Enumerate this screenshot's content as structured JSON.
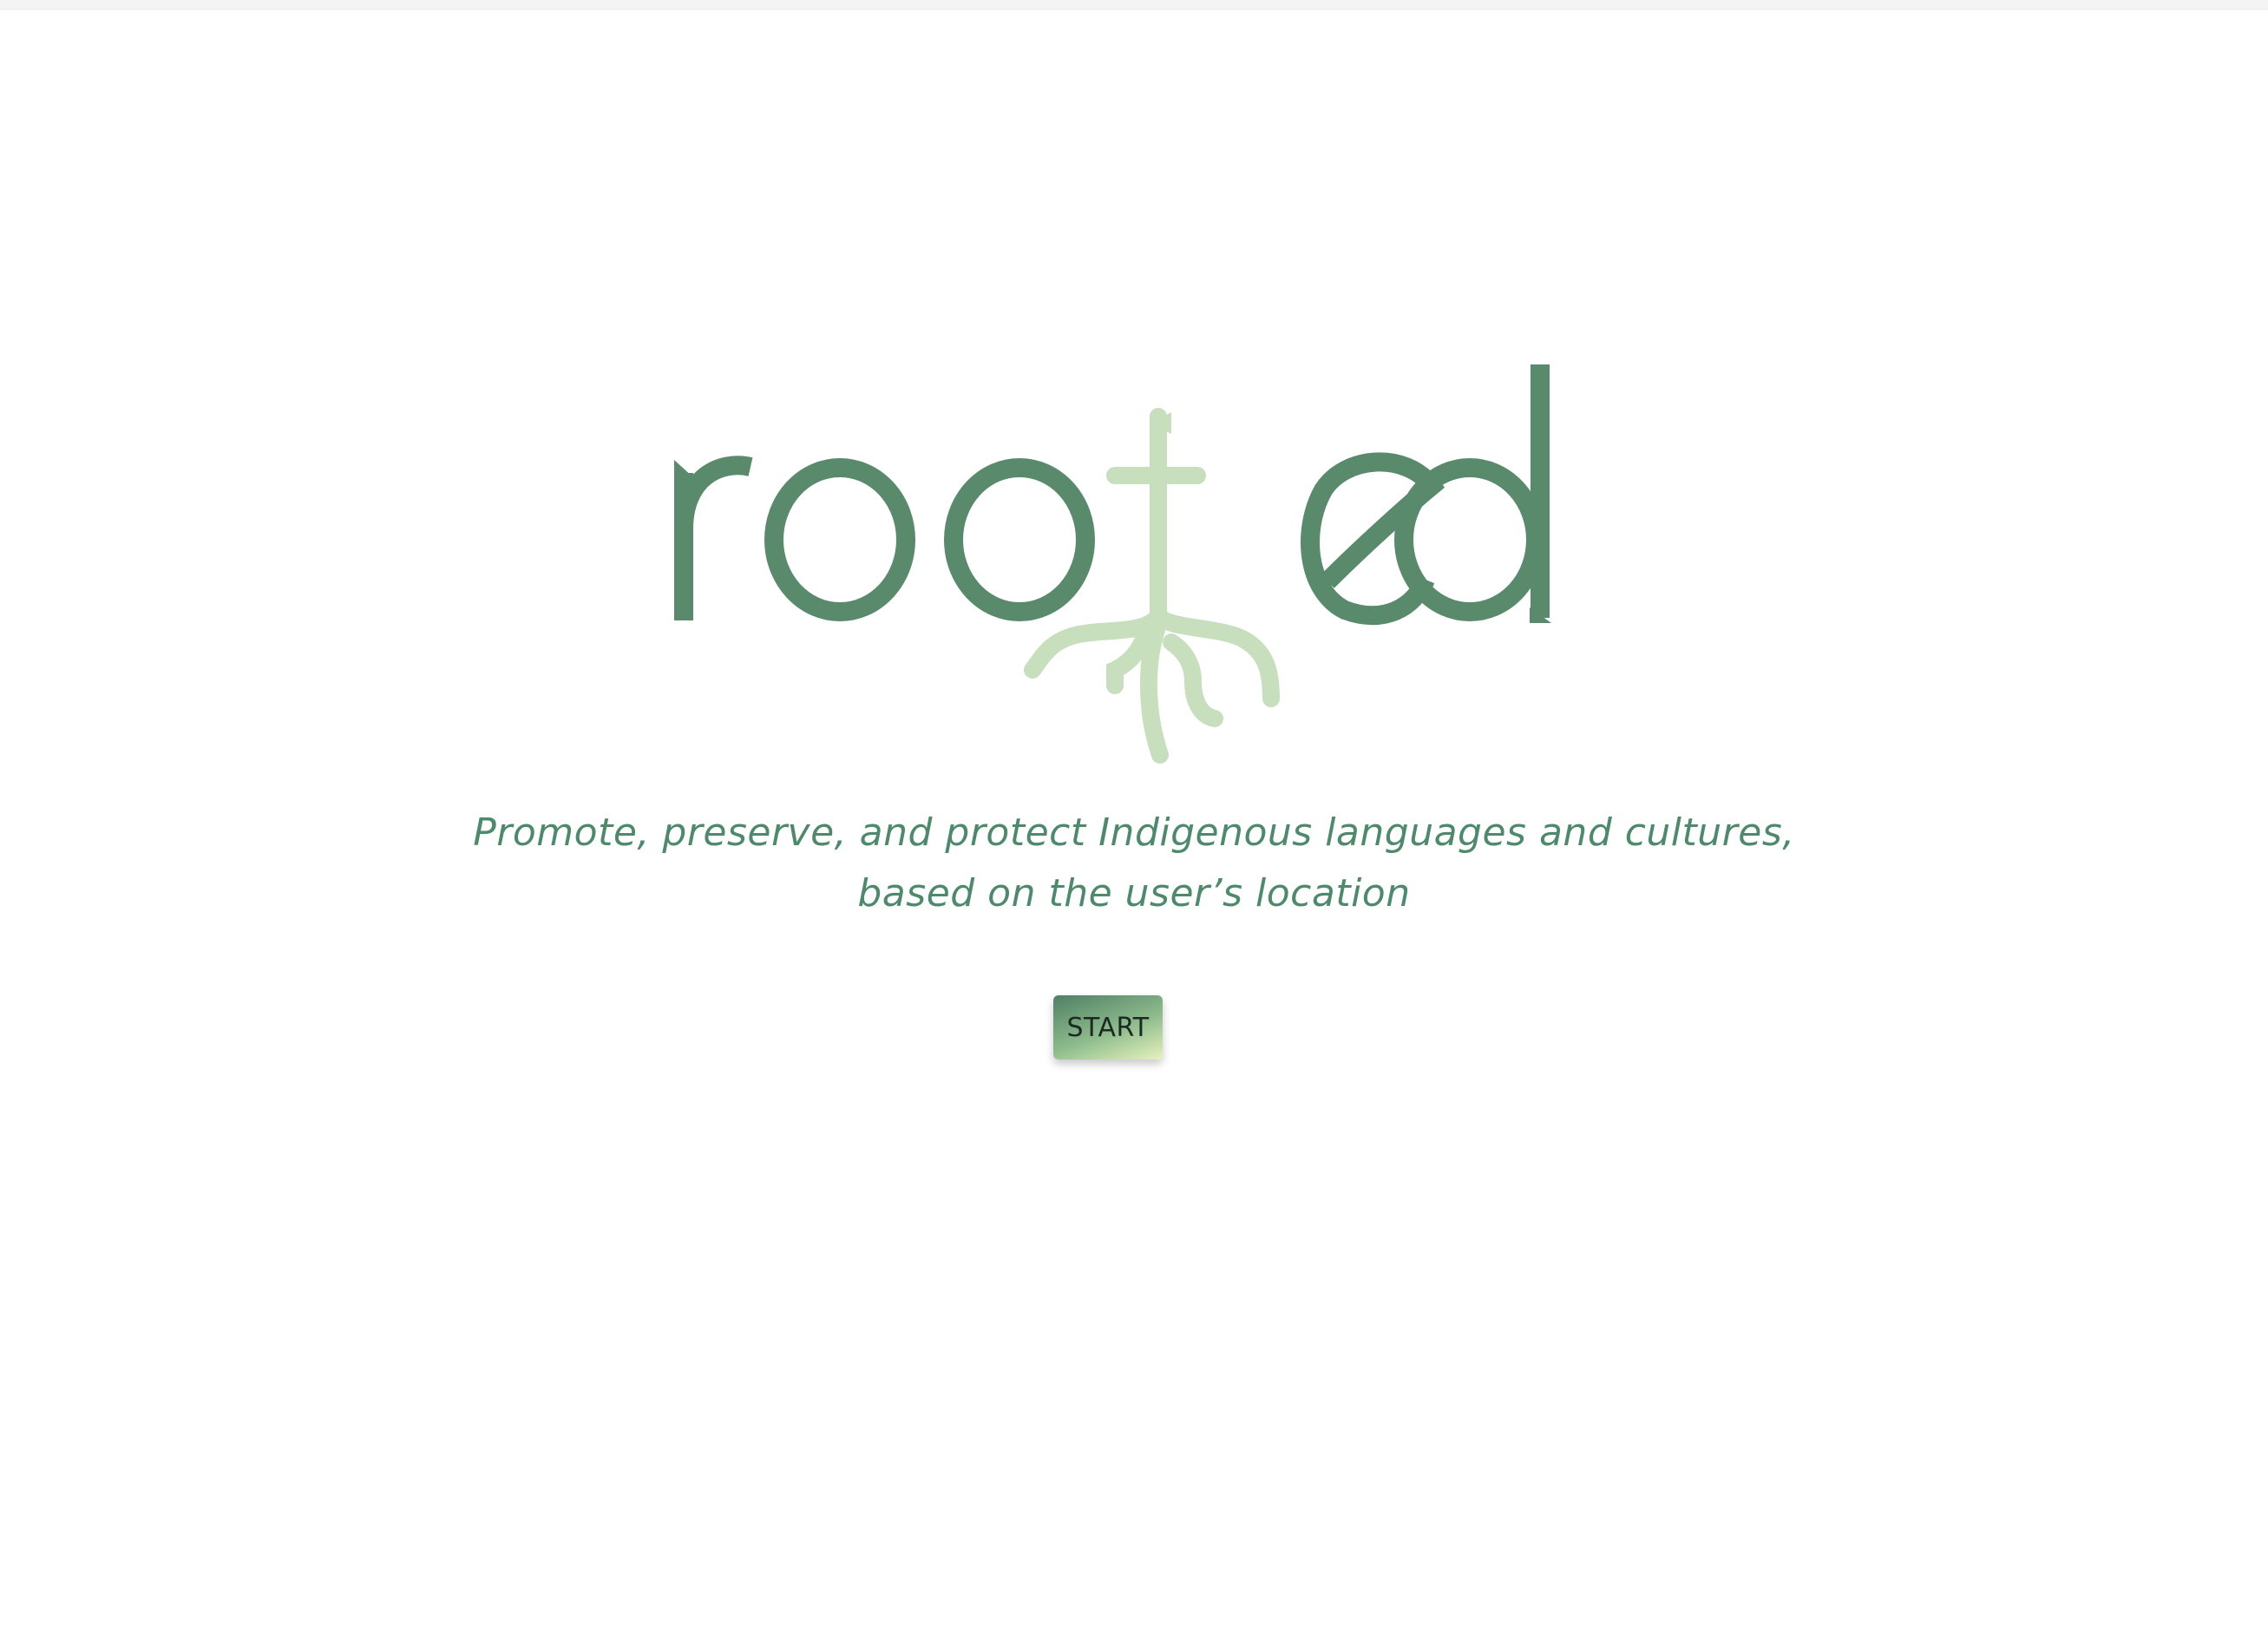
{
  "app": {
    "logo_text": "rooted",
    "logo_colors": {
      "letters": "#5a8a6c",
      "root": "#c7dfbd"
    }
  },
  "tagline": {
    "line1": "Promote, preserve, and protect Indigenous languages and cultures,",
    "line2": "based on the user’s location",
    "color": "#4d8a6b"
  },
  "start_button": {
    "label": "START",
    "gradient": [
      "#4f7f64",
      "#8dbb8c",
      "#e6f2bd"
    ]
  }
}
